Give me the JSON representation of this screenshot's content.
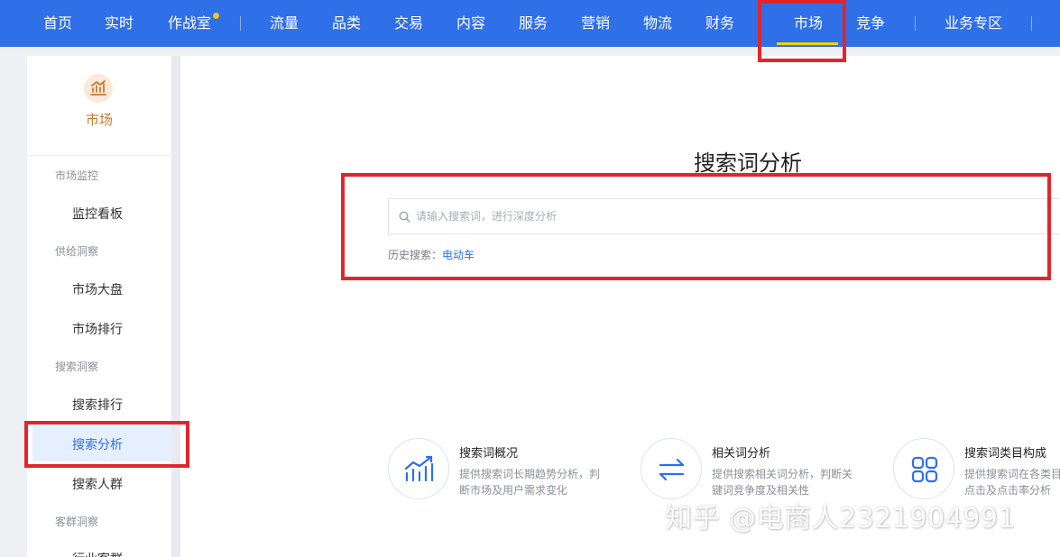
{
  "nav": {
    "items": [
      "首页",
      "实时",
      "作战室",
      "流量",
      "品类",
      "交易",
      "内容",
      "服务",
      "营销",
      "物流",
      "财务",
      "市场",
      "竞争",
      "业务专区"
    ]
  },
  "sidebar": {
    "module_label": "市场",
    "groups": [
      {
        "title": "市场监控",
        "items": [
          "监控看板"
        ]
      },
      {
        "title": "供给洞察",
        "items": [
          "市场大盘",
          "市场排行"
        ]
      },
      {
        "title": "搜索洞察",
        "items": [
          "搜索排行",
          "搜索分析",
          "搜索人群"
        ]
      },
      {
        "title": "客群洞察",
        "items": [
          "行业客群"
        ]
      }
    ],
    "active_item": "搜索分析"
  },
  "main": {
    "title": "搜索词分析",
    "search": {
      "placeholder": "请输入搜索词，进行深度分析",
      "value": ""
    },
    "history": {
      "label": "历史搜索：",
      "link": "电动车"
    },
    "features": [
      {
        "icon": "trend-chart-icon",
        "title": "搜索词概况",
        "desc": [
          "提供搜索词长期趋势分析，判",
          "断市场及用户需求变化"
        ]
      },
      {
        "icon": "swap-arrows-icon",
        "title": "相关词分析",
        "desc": [
          "提供搜索相关词分析，判断关",
          "键词竞争度及相关性"
        ]
      },
      {
        "icon": "grid-icon",
        "title": "搜索词类目构成",
        "desc": [
          "提供搜索词在各类目",
          "点击及点击率分析"
        ]
      }
    ]
  },
  "watermark": "知乎 @电商人2321904991",
  "colors": {
    "nav_bg": "#2f6fe8",
    "highlight": "#e3252b",
    "market_orange": "#c97a2d",
    "link_blue": "#2f6fe8"
  }
}
